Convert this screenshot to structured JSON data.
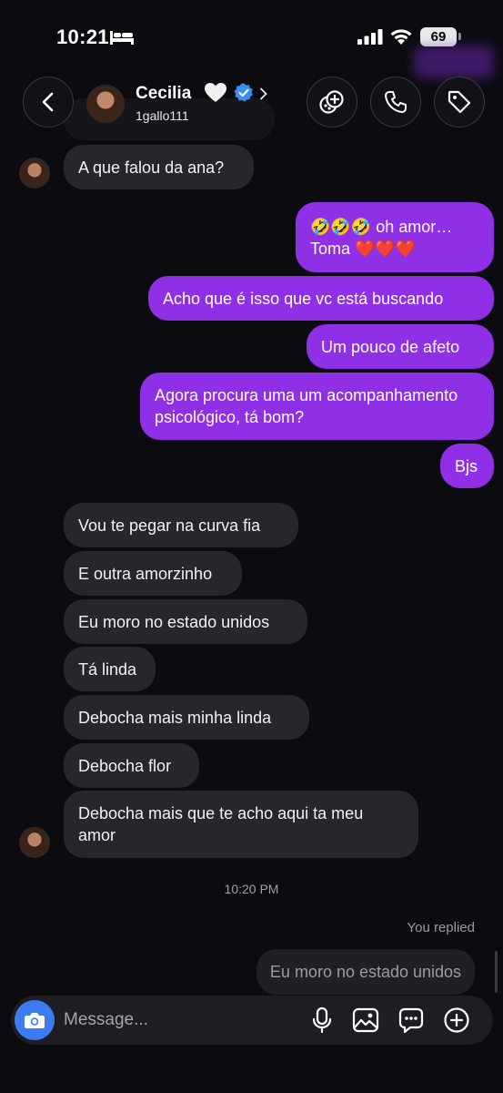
{
  "status_bar": {
    "time": "10:21",
    "battery": "69"
  },
  "header": {
    "name": "Cecilia",
    "username": "1gallo111",
    "heart": "🤍"
  },
  "messages": [
    {
      "side": "in",
      "text": "A que falou da ana?"
    },
    {
      "side": "out",
      "text": "🤣🤣🤣 oh amor… Toma ❤️❤️❤️"
    },
    {
      "side": "out",
      "text": "Acho que é isso que vc está buscando"
    },
    {
      "side": "out",
      "text": "Um pouco de afeto"
    },
    {
      "side": "out",
      "text": "Agora procura uma um acompanhamento psicológico, tá bom?"
    },
    {
      "side": "out",
      "text": "Bjs"
    },
    {
      "side": "in",
      "text": "Vou te pegar na curva fia"
    },
    {
      "side": "in",
      "text": "E outra amorzinho"
    },
    {
      "side": "in",
      "text": "Eu moro no estado unidos"
    },
    {
      "side": "in",
      "text": "Tá linda"
    },
    {
      "side": "in",
      "text": "Debocha mais minha linda"
    },
    {
      "side": "in",
      "text": "Debocha flor"
    },
    {
      "side": "in",
      "text": "Debocha mais que te acho aqui ta meu amor"
    }
  ],
  "timestamp": "10:20 PM",
  "reply": {
    "label": "You replied",
    "quoted_text": "Eu moro no estado unidos"
  },
  "composer": {
    "placeholder": "Message..."
  },
  "colors": {
    "outgoing": "#8f2fe6",
    "incoming": "#26262c",
    "camera": "#3d7cf0"
  },
  "icons": [
    "back-icon",
    "heart-icon",
    "verified-icon",
    "chevron-right-icon",
    "video-call-icon",
    "phone-icon",
    "tag-icon",
    "camera-icon",
    "microphone-icon",
    "image-icon",
    "sticker-icon",
    "plus-icon"
  ]
}
